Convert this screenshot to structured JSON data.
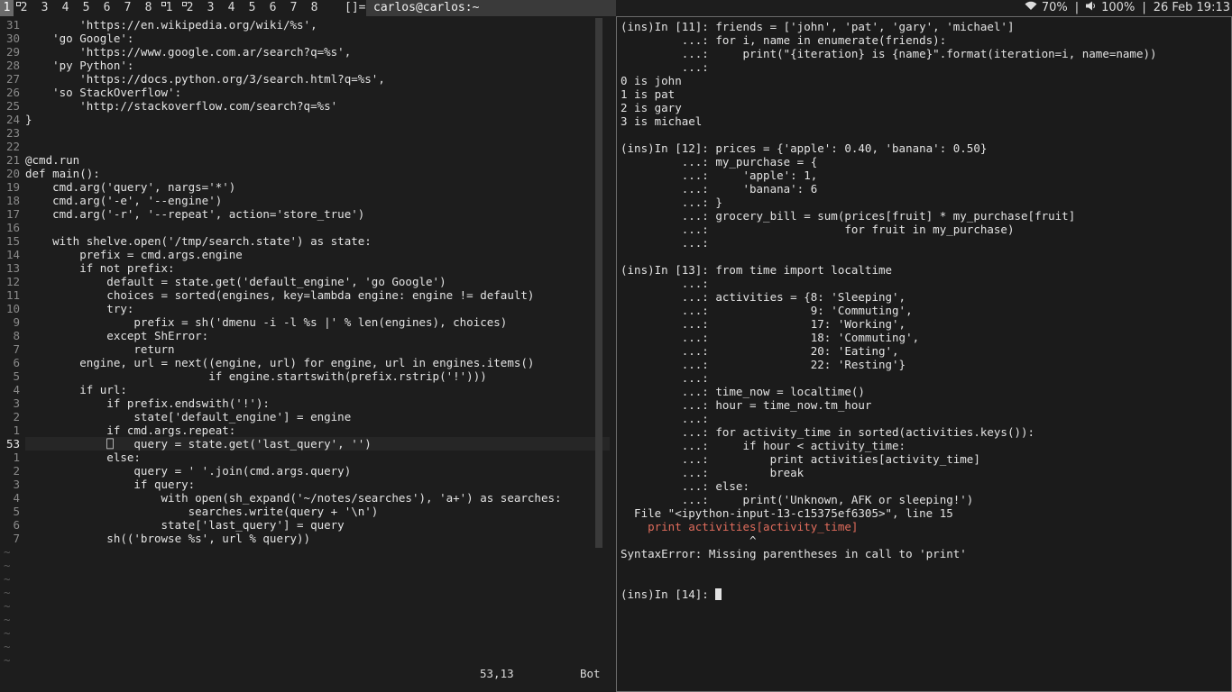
{
  "topbar": {
    "tags": [
      {
        "label": "1",
        "selected": true,
        "occupied": false
      },
      {
        "label": "2",
        "selected": false,
        "occupied": true
      },
      {
        "label": "3",
        "selected": false,
        "occupied": false
      },
      {
        "label": "4",
        "selected": false,
        "occupied": false
      },
      {
        "label": "5",
        "selected": false,
        "occupied": false
      },
      {
        "label": "6",
        "selected": false,
        "occupied": false
      },
      {
        "label": "7",
        "selected": false,
        "occupied": false
      },
      {
        "label": "8",
        "selected": false,
        "occupied": false
      },
      {
        "label": "1",
        "selected": false,
        "occupied": true
      },
      {
        "label": "2",
        "selected": false,
        "occupied": true
      },
      {
        "label": "3",
        "selected": false,
        "occupied": false
      },
      {
        "label": "4",
        "selected": false,
        "occupied": false
      },
      {
        "label": "5",
        "selected": false,
        "occupied": false
      },
      {
        "label": "6",
        "selected": false,
        "occupied": false
      },
      {
        "label": "7",
        "selected": false,
        "occupied": false
      },
      {
        "label": "8",
        "selected": false,
        "occupied": false
      }
    ],
    "layout_symbol": "[]=",
    "window_title": "carlos@carlos:~",
    "wifi": "70%",
    "volume": "100%",
    "date": "26 Feb 19:13"
  },
  "vim": {
    "lines": [
      {
        "n": "31",
        "code": "        'https://en.wikipedia.org/wiki/%s',"
      },
      {
        "n": "30",
        "code": "    'go Google':"
      },
      {
        "n": "29",
        "code": "        'https://www.google.com.ar/search?q=%s',"
      },
      {
        "n": "28",
        "code": "    'py Python':"
      },
      {
        "n": "27",
        "code": "        'https://docs.python.org/3/search.html?q=%s',"
      },
      {
        "n": "26",
        "code": "    'so StackOverflow':"
      },
      {
        "n": "25",
        "code": "        'http://stackoverflow.com/search?q=%s'"
      },
      {
        "n": "24",
        "code": "}"
      },
      {
        "n": "23",
        "code": ""
      },
      {
        "n": "22",
        "code": ""
      },
      {
        "n": "21",
        "code": "@cmd.run"
      },
      {
        "n": "20",
        "code": "def main():"
      },
      {
        "n": "19",
        "code": "    cmd.arg('query', nargs='*')"
      },
      {
        "n": "18",
        "code": "    cmd.arg('-e', '--engine')"
      },
      {
        "n": "17",
        "code": "    cmd.arg('-r', '--repeat', action='store_true')"
      },
      {
        "n": "16",
        "code": ""
      },
      {
        "n": "15",
        "code": "    with shelve.open('/tmp/search.state') as state:"
      },
      {
        "n": "14",
        "code": "        prefix = cmd.args.engine"
      },
      {
        "n": "13",
        "code": "        if not prefix:"
      },
      {
        "n": "12",
        "code": "            default = state.get('default_engine', 'go Google')"
      },
      {
        "n": "11",
        "code": "            choices = sorted(engines, key=lambda engine: engine != default)"
      },
      {
        "n": "10",
        "code": "            try:"
      },
      {
        "n": "9",
        "code": "                prefix = sh('dmenu -i -l %s |' % len(engines), choices)"
      },
      {
        "n": "8",
        "code": "            except ShError:"
      },
      {
        "n": "7",
        "code": "                return"
      },
      {
        "n": "6",
        "code": "        engine, url = next((engine, url) for engine, url in engines.items()"
      },
      {
        "n": "5",
        "code": "                           if engine.startswith(prefix.rstrip('!')))"
      },
      {
        "n": "4",
        "code": "        if url:"
      },
      {
        "n": "3",
        "code": "            if prefix.endswith('!'):"
      },
      {
        "n": "2",
        "code": "                state['default_engine'] = engine"
      },
      {
        "n": "1",
        "code": "            if cmd.args.repeat:"
      },
      {
        "n": "53",
        "code": "            ⎕   query = state.get('last_query', '')",
        "current": true
      },
      {
        "n": "1",
        "code": "            else:"
      },
      {
        "n": "2",
        "code": "                query = ' '.join(cmd.args.query)"
      },
      {
        "n": "3",
        "code": "                if query:"
      },
      {
        "n": "4",
        "code": "                    with open(sh_expand('~/notes/searches'), 'a+') as searches:"
      },
      {
        "n": "5",
        "code": "                        searches.write(query + '\\n')"
      },
      {
        "n": "6",
        "code": "                    state['last_query'] = query"
      },
      {
        "n": "7",
        "code": "            sh(('browse %s', url % query))"
      }
    ],
    "tildes": 9,
    "position": "53,13",
    "scroll": "Bot"
  },
  "ipython": {
    "lines": [
      "(ins)In [11]: friends = ['john', 'pat', 'gary', 'michael']",
      "         ...: for i, name in enumerate(friends):",
      "         ...:     print(\"{iteration} is {name}\".format(iteration=i, name=name))",
      "         ...:",
      "0 is john",
      "1 is pat",
      "2 is gary",
      "3 is michael",
      "",
      "(ins)In [12]: prices = {'apple': 0.40, 'banana': 0.50}",
      "         ...: my_purchase = {",
      "         ...:     'apple': 1,",
      "         ...:     'banana': 6",
      "         ...: }",
      "         ...: grocery_bill = sum(prices[fruit] * my_purchase[fruit]",
      "         ...:                    for fruit in my_purchase)",
      "         ...:",
      "",
      "(ins)In [13]: from time import localtime",
      "         ...:",
      "         ...: activities = {8: 'Sleeping',",
      "         ...:               9: 'Commuting',",
      "         ...:               17: 'Working',",
      "         ...:               18: 'Commuting',",
      "         ...:               20: 'Eating',",
      "         ...:               22: 'Resting'}",
      "         ...:",
      "         ...: time_now = localtime()",
      "         ...: hour = time_now.tm_hour",
      "         ...:",
      "         ...: for activity_time in sorted(activities.keys()):",
      "         ...:     if hour < activity_time:",
      "         ...:         print activities[activity_time]",
      "         ...:         break",
      "         ...: else:",
      "         ...:     print('Unknown, AFK or sleeping!')",
      "  File \"<ipython-input-13-c15375ef6305>\", line 15",
      "    print activities[activity_time]",
      "                   ^",
      "SyntaxError: Missing parentheses in call to 'print'",
      "",
      "",
      "(ins)In [14]: "
    ]
  }
}
